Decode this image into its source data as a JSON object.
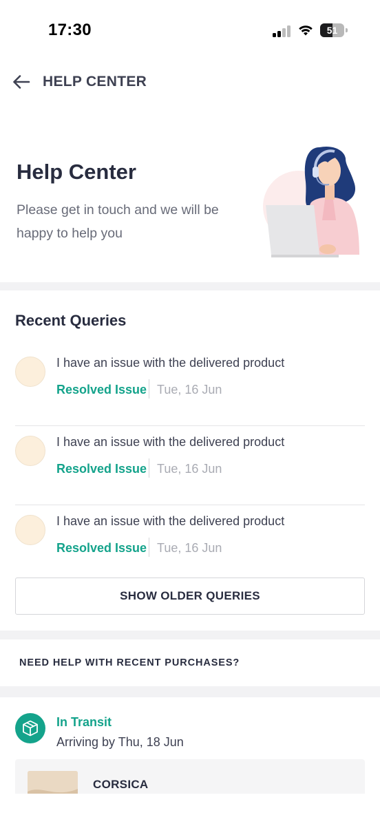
{
  "status_bar": {
    "time": "17:30",
    "battery_text": "51",
    "battery_level": 0.51,
    "icons": [
      "cellular-signal-icon",
      "wifi-icon",
      "battery-icon"
    ]
  },
  "header": {
    "back_icon": "arrow-left-icon",
    "title": "HELP CENTER"
  },
  "hero": {
    "title": "Help Center",
    "subtitle": "Please get in touch and we will be happy to help you",
    "illustration": "support-agent-illustration"
  },
  "recent_queries": {
    "title": "Recent Queries",
    "items": [
      {
        "text": "I have an issue with the delivered product",
        "status": "Resolved Issue",
        "date": "Tue, 16 Jun"
      },
      {
        "text": "I have an issue with the delivered product",
        "status": "Resolved Issue",
        "date": "Tue, 16 Jun"
      },
      {
        "text": "I have an issue with the delivered product",
        "status": "Resolved Issue",
        "date": "Tue, 16 Jun"
      }
    ],
    "show_older_label": "SHOW OLDER QUERIES"
  },
  "purchases": {
    "title": "NEED HELP WITH RECENT PURCHASES?",
    "order": {
      "icon": "package-box-icon",
      "status": "In Transit",
      "eta": "Arriving by Thu, 18 Jun",
      "brand": "CORSICA"
    }
  },
  "colors": {
    "accent_green": "#14a38b",
    "text_primary": "#282c3f",
    "text_secondary": "#686b78",
    "divider": "#f2f2f4",
    "avatar_bg": "#fcefdc"
  }
}
